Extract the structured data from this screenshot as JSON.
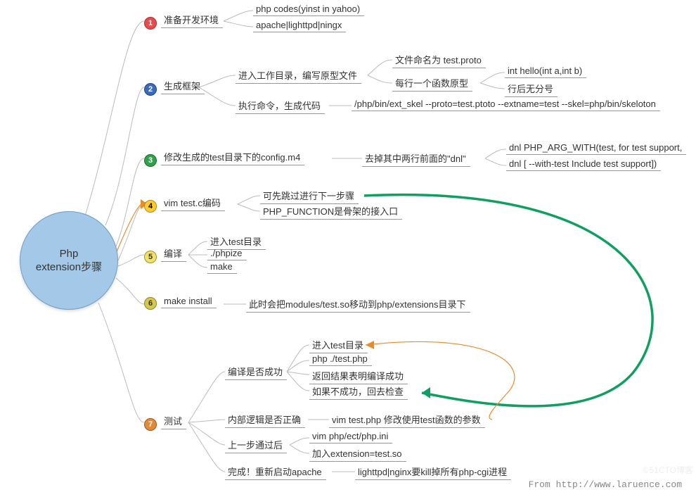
{
  "root": "Php\nextension步骤",
  "attribution": "From http://www.laruence.com",
  "watermark": "©51CTO博客",
  "steps": {
    "s1": {
      "num": "1",
      "label": "准备开发环境",
      "c": [
        "php codes(yinst in yahoo)",
        "apache|lighttpd|ningx"
      ]
    },
    "s2": {
      "num": "2",
      "label": "生成框架",
      "c1": {
        "label": "进入工作目录，编写原型文件",
        "c": [
          {
            "label": "文件命名为 test.proto"
          },
          {
            "label": "每行一个函数原型",
            "c": [
              "int hello(int a,int b)",
              "行后无分号"
            ]
          }
        ]
      },
      "c2": {
        "label": "执行命令，生成代码",
        "c": [
          "/php/bin/ext_skel --proto=test.ptoto --extname=test --skel=php/bin/skeloton"
        ]
      }
    },
    "s3": {
      "num": "3",
      "label": "修改生成的test目录下的config.m4",
      "c": [
        {
          "label": "去掉其中两行前面的\"dnl\"",
          "c": [
            "dnl PHP_ARG_WITH(test, for test support,",
            "dnl [  --with-test            Include test support])"
          ]
        }
      ]
    },
    "s4": {
      "num": "4",
      "label": "vim test.c编码",
      "c": [
        "可先跳过进行下一步骤",
        "PHP_FUNCTION是骨架的接入口"
      ]
    },
    "s5": {
      "num": "5",
      "label": "编译",
      "c": [
        "进入test目录",
        "./phpize",
        "make"
      ]
    },
    "s6": {
      "num": "6",
      "label": "make install",
      "c": [
        "此时会把modules/test.so移动到php/extensions目录下"
      ]
    },
    "s7": {
      "num": "7",
      "label": "测试",
      "c1": {
        "label": "编译是否成功",
        "c": [
          "进入test目录",
          "php ./test.php",
          "返回结果表明编译成功",
          "如果不成功，回去检查"
        ]
      },
      "c2": {
        "label": "内部逻辑是否正确",
        "c": [
          "vim test.php 修改使用test函数的参数"
        ]
      },
      "c3": {
        "label": "上一步通过后",
        "c": [
          "vim php/ect/php.ini",
          "加入extension=test.so"
        ]
      },
      "c4": {
        "label": "完成！重新启动apache",
        "c": [
          "lighttpd|nginx要kill掉所有php-cgi进程"
        ]
      }
    }
  }
}
